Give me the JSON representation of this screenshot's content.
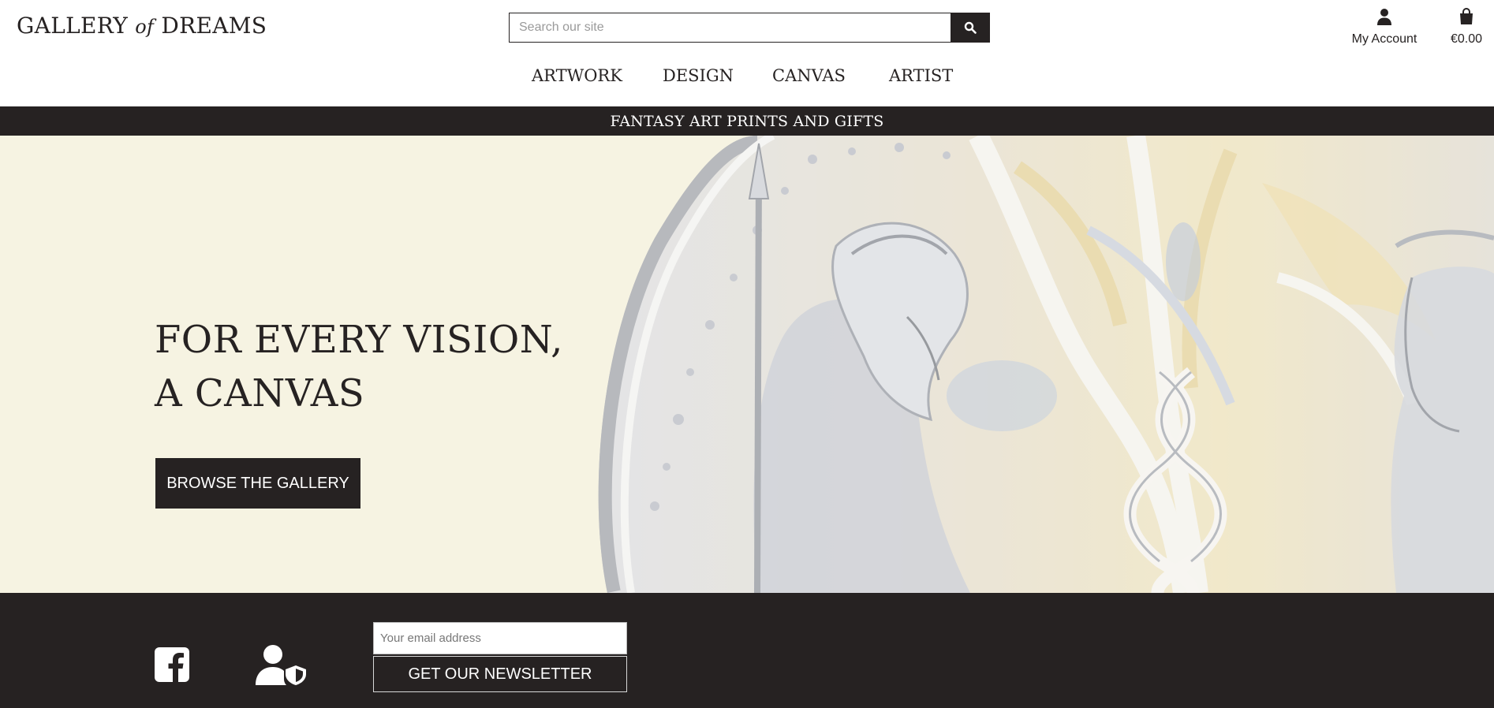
{
  "header": {
    "logo": {
      "part1": "GALLERY ",
      "part2": "of",
      "part3": " DREAMS"
    },
    "search": {
      "placeholder": "Search our site",
      "value": ""
    },
    "account_label": "My Account",
    "cart_total": "€0.00"
  },
  "nav": {
    "items": [
      {
        "label": "ARTWORK"
      },
      {
        "label": "DESIGN"
      },
      {
        "label": "CANVAS"
      },
      {
        "label": "ARTIST"
      }
    ]
  },
  "banner": {
    "text": "FANTASY ART PRINTS AND GIFTS"
  },
  "hero": {
    "title_line1": "FOR EVERY VISION,",
    "title_line2": "A CANVAS",
    "button_label": "BROWSE THE GALLERY",
    "background_color": "#f6f3e2"
  },
  "footer": {
    "email_placeholder": "Your email address",
    "newsletter_button": "GET OUR NEWSLETTER",
    "icons": [
      "facebook-icon",
      "privacy-icon"
    ]
  },
  "colors": {
    "dark": "#262222",
    "cream": "#f6f3e2",
    "white": "#ffffff"
  }
}
